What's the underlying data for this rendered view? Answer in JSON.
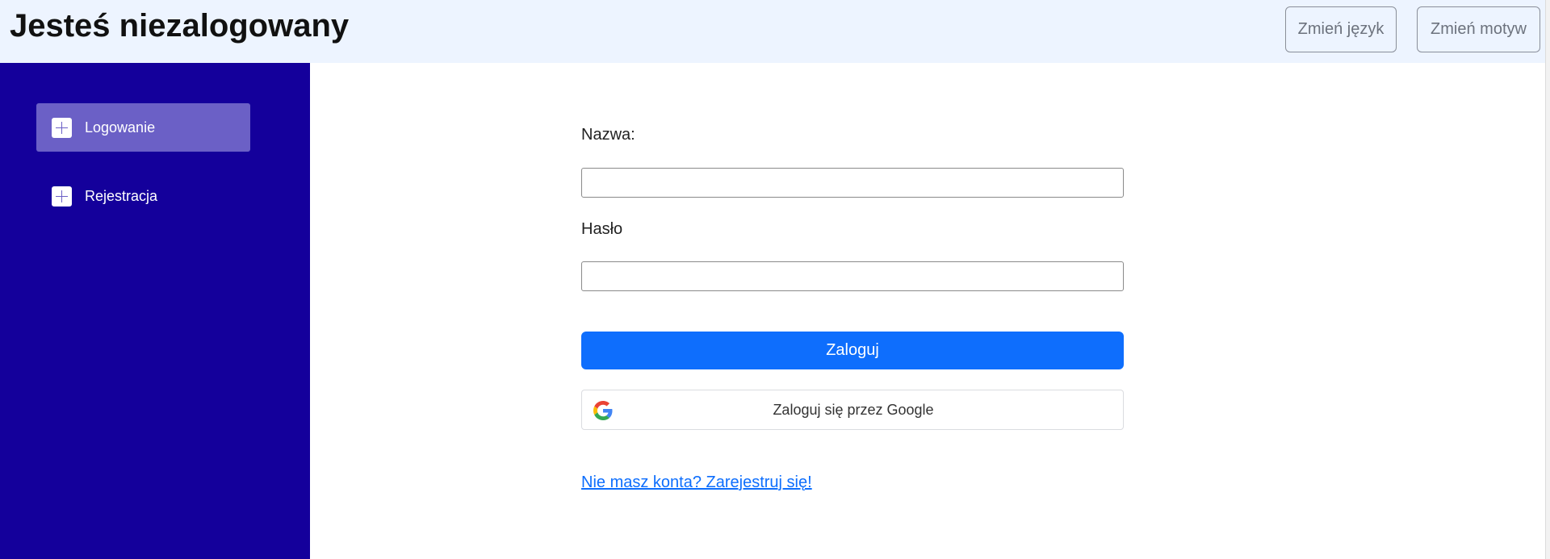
{
  "header": {
    "title": "Jesteś niezalogowany",
    "change_language_label": "Zmień język",
    "change_theme_label": "Zmień motyw"
  },
  "sidebar": {
    "items": [
      {
        "label": "Logowanie",
        "icon": "plus-icon",
        "active": true
      },
      {
        "label": "Rejestracja",
        "icon": "plus-icon",
        "active": false
      }
    ]
  },
  "login_form": {
    "username_label": "Nazwa:",
    "username_value": "",
    "password_label": "Hasło",
    "password_value": "",
    "submit_label": "Zaloguj",
    "google_label": "Zaloguj się przez Google",
    "register_link": "Nie masz konta? Zarejestruj się!"
  },
  "colors": {
    "header_bg": "#edf4ff",
    "sidebar_bg": "#14009b",
    "sidebar_active_bg": "#6b60c6",
    "primary": "#0e6efd",
    "link": "#0d6efd"
  }
}
